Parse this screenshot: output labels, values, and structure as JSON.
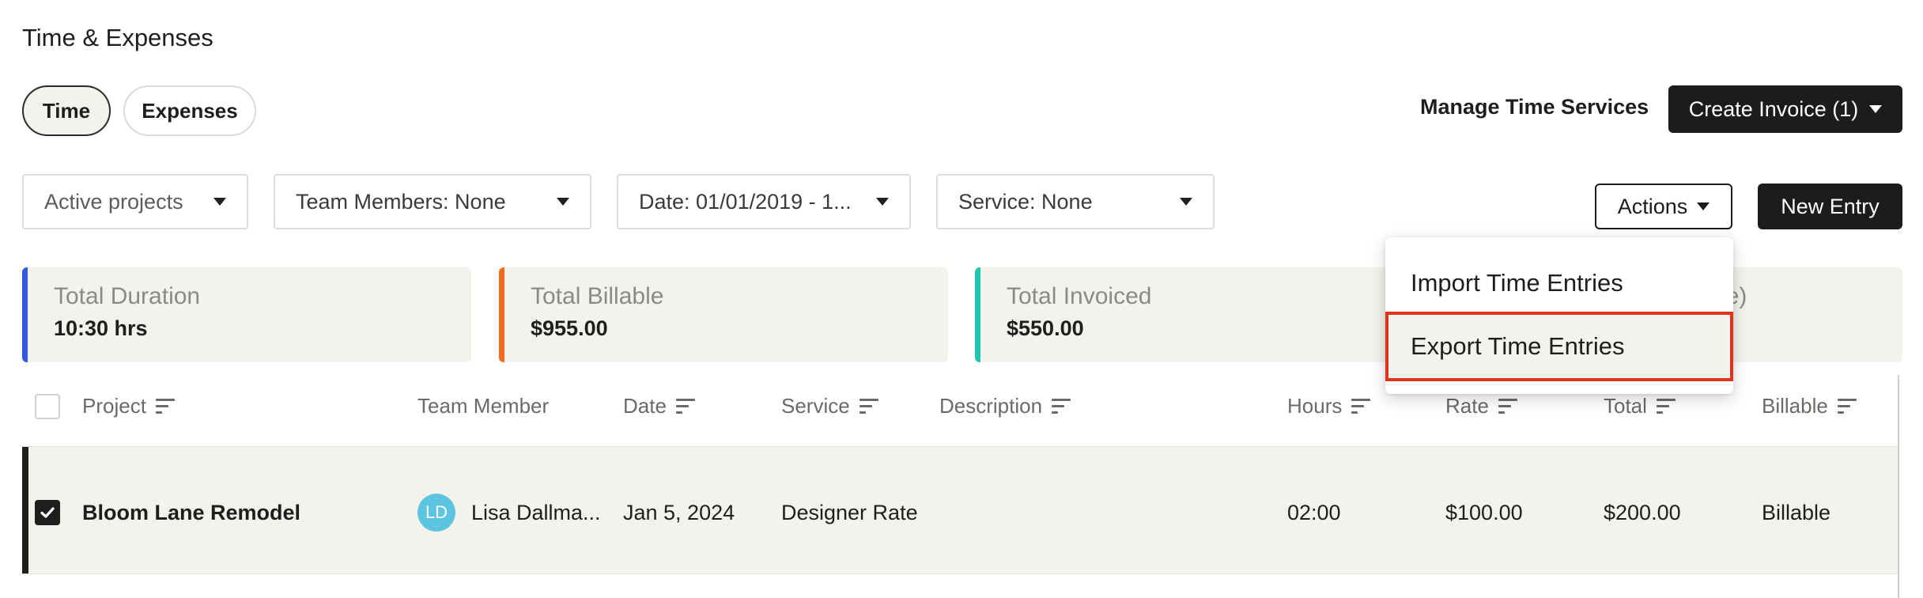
{
  "page": {
    "title": "Time & Expenses"
  },
  "tabs": [
    {
      "label": "Time",
      "active": true
    },
    {
      "label": "Expenses",
      "active": false
    }
  ],
  "header_actions": {
    "manage_label": "Manage Time Services",
    "create_invoice_label": "Create Invoice (1)"
  },
  "filters": {
    "projects": "Active projects",
    "team_members": "Team Members: None",
    "date": "Date: 01/01/2019 - 1...",
    "service": "Service: None"
  },
  "toolbar": {
    "actions_label": "Actions",
    "new_entry_label": "New Entry"
  },
  "actions_menu": {
    "items": [
      {
        "label": "Import Time Entries",
        "highlighted": false
      },
      {
        "label": "Export Time Entries",
        "highlighted": true
      }
    ]
  },
  "summary_cards": [
    {
      "label": "Total Duration",
      "value": "10:30 hrs",
      "color": "#2f5be0"
    },
    {
      "label": "Total Billable",
      "value": "$955.00",
      "color": "#ef6b1f"
    },
    {
      "label": "Total Invoiced",
      "value": "$550.00",
      "color": "#1fc7b0"
    },
    {
      "label": "le)",
      "value": "",
      "color": "#7d5ce0"
    }
  ],
  "table": {
    "columns": [
      "Project",
      "Team Member",
      "Date",
      "Service",
      "Description",
      "Hours",
      "Rate",
      "Total",
      "Billable"
    ],
    "rows": [
      {
        "checked": true,
        "project": "Bloom Lane Remodel",
        "team_member_initials": "LD",
        "team_member": "Lisa Dallma...",
        "date": "Jan 5, 2024",
        "service": "Designer Rate",
        "description": "",
        "hours": "02:00",
        "rate": "$100.00",
        "total": "$200.00",
        "billable": "Billable"
      }
    ]
  },
  "colors": {
    "highlight_border": "#e0321c",
    "dark_button": "#1c1c1c",
    "card_bg": "#f4f2ec"
  }
}
